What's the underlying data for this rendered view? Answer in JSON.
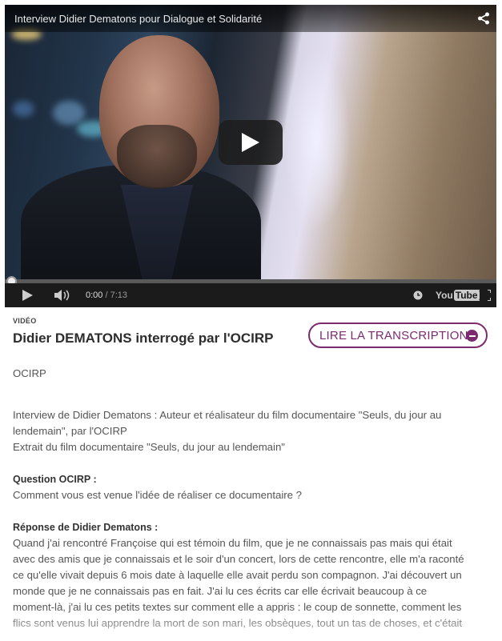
{
  "video": {
    "title": "Interview Didier Dematons pour Dialogue et Solidarité",
    "current_time": "0:00",
    "duration": "/ 7:13",
    "youtube_label": "You",
    "youtube_tube": "Tube",
    "progress": 0
  },
  "article": {
    "kicker": "VIDÉO",
    "title": "Didier DEMATONS interrogé par l'OCIRP",
    "transcript_button": "LIRE LA TRANSCRIPTION",
    "source": "OCIRP",
    "intro_line1": "Interview de Didier Dematons : Auteur et réalisateur du film documentaire \"Seuls, du jour au",
    "intro_line2": "lendemain\", par l'OCIRP",
    "intro_line3": "Extrait du film documentaire \"Seuls, du jour au lendemain\"",
    "question_label": "Question OCIRP :",
    "question_text": "Comment vous est venue l'idée de réaliser ce documentaire ?",
    "answer_label": "Réponse de Didier Dematons :",
    "answer_lines": [
      "Quand j'ai rencontré Françoise qui est témoin du film, que je ne connaissais pas mais qui était",
      "avec des amis que je connaissais et le soir d'un concert, lors de cette rencontre,  elle m'a raconté",
      "ce qu'elle vivait depuis 6 mois date à laquelle elle avait perdu son compagnon. J'ai découvert un",
      "monde que je ne connaissais pas en fait. J'ai lu ces écrits car elle écrivait beaucoup à ce",
      "moment-là, j'ai lu ces petits textes sur comment elle a appris  : le coup de sonnette, comment les",
      "flics sont venus lui apprendre la mort de son mari, les obsèques, tout un tas de choses, et c'était"
    ]
  },
  "colors": {
    "accent": "#7b2b6e",
    "player_bg": "#1b1b1b"
  }
}
